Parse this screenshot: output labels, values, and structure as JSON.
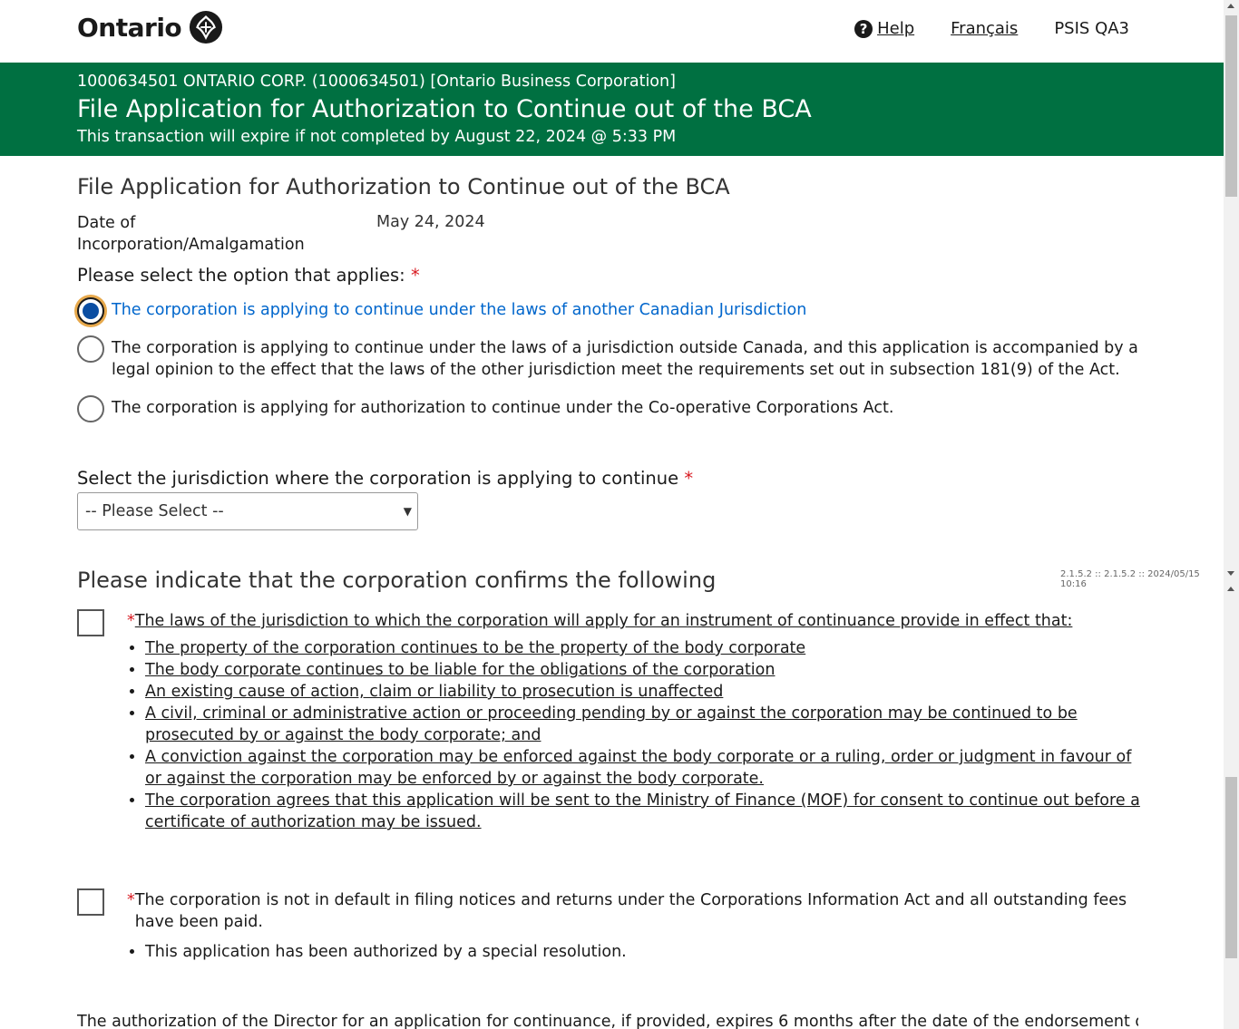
{
  "header": {
    "logo_text": "Ontario",
    "help_label": "Help",
    "language_label": "Français",
    "environment_label": "PSIS QA3"
  },
  "banner": {
    "corporation": "1000634501 ONTARIO CORP. (1000634501) [Ontario Business Corporation]",
    "title": "File Application for Authorization to Continue out of the BCA",
    "expiry": "This transaction will expire if not completed by August 22, 2024 @ 5:33 PM"
  },
  "form": {
    "section_title": "File Application for Authorization to Continue out of the BCA",
    "doi_label": "Date of Incorporation/Amalgamation",
    "doi_value": "May 24, 2024",
    "option_label": "Please select the option that applies:",
    "required_mark": "*",
    "options": [
      {
        "label": "The corporation is applying to continue under the laws of another Canadian Jurisdiction",
        "selected": true
      },
      {
        "label": "The corporation is applying to continue under the laws of a jurisdiction outside Canada, and this application is accompanied by a legal opinion to the effect that the laws of the other jurisdiction meet the requirements set out in subsection 181(9) of the Act.",
        "selected": false
      },
      {
        "label": "The corporation is applying for authorization to continue under the Co-operative Corporations Act.",
        "selected": false
      }
    ],
    "jurisdiction_label": "Select the jurisdiction where the corporation is applying to continue",
    "jurisdiction_select": "-- Please Select --"
  },
  "confirm": {
    "title": "Please indicate that the corporation confirms the following",
    "version": "2.1.5.2 :: 2.1.5.2 :: 2024/05/15 10:16",
    "item1_text": "The laws of the jurisdiction to which the corporation will apply for an instrument of continuance provide in effect that:",
    "item1_bullets": [
      "The property of the corporation continues to be the property of the body corporate",
      "The body corporate continues to be liable for the obligations of the corporation",
      "An existing cause of action, claim or liability to prosecution is unaffected",
      "A civil, criminal or administrative action or proceeding pending by or against the corporation may be continued to be prosecuted by or against the body corporate; and",
      "A conviction against the corporation may be enforced against the body corporate or a ruling, order or judgment in favour of or against the corporation may be enforced by or against the body corporate.",
      "The corporation agrees that this application will be sent to the Ministry of Finance (MOF) for consent to continue out before a certificate of authorization may be issued."
    ],
    "item2_text": "The corporation is not in default in filing notices and returns under the Corporations Information Act and all outstanding fees have been paid.",
    "item2_bullets": [
      "This application has been authorized by a special resolution."
    ]
  },
  "footer_text": "The authorization of the Director for an application for continuance, if provided, expires 6 months after the date of the endorsement of the"
}
